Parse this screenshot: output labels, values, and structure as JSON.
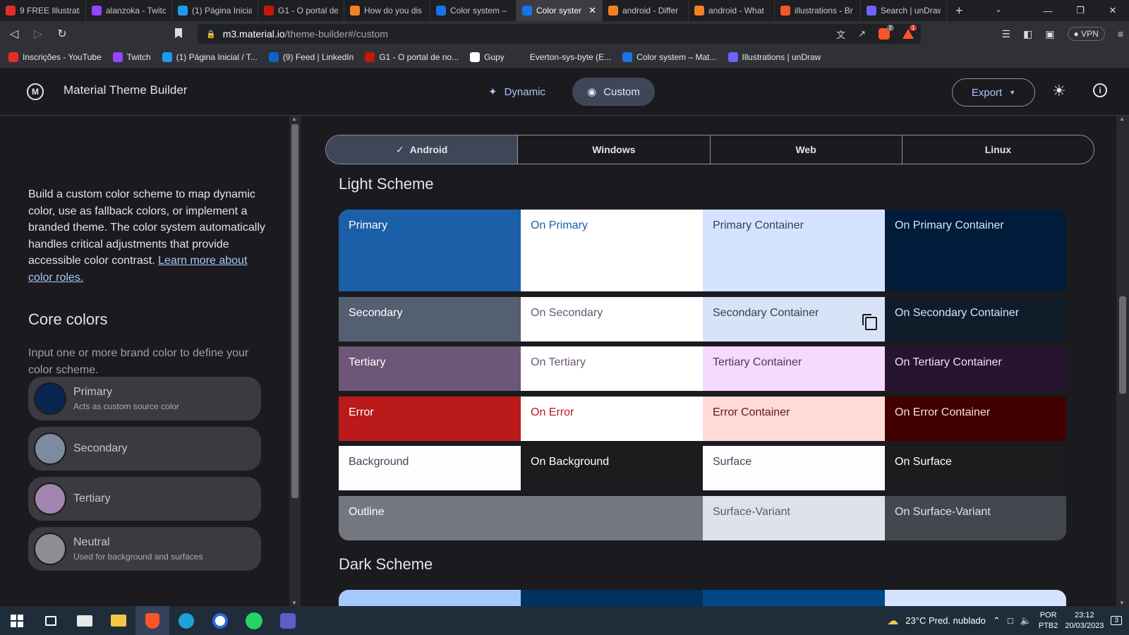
{
  "browser": {
    "tabs": [
      {
        "label": "9 FREE Illustratic",
        "fav_color": "#e52d27",
        "fav_icon": "youtube-icon"
      },
      {
        "label": "alanzoka - Twitc",
        "fav_color": "#9146ff",
        "fav_icon": "twitch-icon"
      },
      {
        "label": "(1) Página Inicia",
        "fav_color": "#1d9bf0",
        "fav_icon": "twitter-icon"
      },
      {
        "label": "G1 - O portal de",
        "fav_color": "#c4170c",
        "fav_icon": "g1-icon"
      },
      {
        "label": "How do you dis",
        "fav_color": "#f48024",
        "fav_icon": "stackoverflow-icon"
      },
      {
        "label": "Color system – ",
        "fav_color": "#1a73e8",
        "fav_icon": "material-icon"
      },
      {
        "label": "Color syster",
        "fav_color": "#1a73e8",
        "fav_icon": "material-icon",
        "active": true
      },
      {
        "label": "android - Differ",
        "fav_color": "#f48024",
        "fav_icon": "stackoverflow-icon"
      },
      {
        "label": "android - What",
        "fav_color": "#f48024",
        "fav_icon": "stackoverflow-icon"
      },
      {
        "label": "illustrations - Br",
        "fav_color": "#fb542b",
        "fav_icon": "brave-search-icon"
      },
      {
        "label": "Search | unDraw",
        "fav_color": "#6c63ff",
        "fav_icon": "undraw-icon"
      }
    ],
    "url_host": "m3.material.io",
    "url_path": "/theme-builder#/custom",
    "brave_badge": "2",
    "alert_badge": "1",
    "vpn_label": "VPN",
    "bookmarks": [
      {
        "label": "Inscrições - YouTube",
        "fav_color": "#e52d27"
      },
      {
        "label": "Twitch",
        "fav_color": "#9146ff"
      },
      {
        "label": "(1) Página Inicial / T...",
        "fav_color": "#1d9bf0"
      },
      {
        "label": "(9) Feed | LinkedIn",
        "fav_color": "#0a66c2"
      },
      {
        "label": "G1 - O portal de no...",
        "fav_color": "#c4170c"
      },
      {
        "label": "Gupy",
        "fav_color": "#ffffff"
      },
      {
        "label": "Everton-sys-byte (E...",
        "fav_color": "#333333"
      },
      {
        "label": "Color system – Mat...",
        "fav_color": "#1a73e8"
      },
      {
        "label": "Illustrations | unDraw",
        "fav_color": "#6c63ff"
      }
    ]
  },
  "header": {
    "title": "Material Theme Builder",
    "dynamic_label": "Dynamic",
    "custom_label": "Custom",
    "export_label": "Export"
  },
  "sidebar": {
    "intro": "Build a custom color scheme to map dynamic color, use as fallback colors, or implement a branded theme. The color system automatically handles critical adjustments that provide accessible color contrast.",
    "learn_more": "Learn more about color roles.",
    "core_title": "Core colors",
    "core_desc": "Input one or more brand color to define your color scheme.",
    "colors": [
      {
        "name": "Primary",
        "sub": "Acts as custom source color",
        "color": "#0a2550"
      },
      {
        "name": "Secondary",
        "sub": "",
        "color": "#7d8aa0"
      },
      {
        "name": "Tertiary",
        "sub": "",
        "color": "#a386b0"
      },
      {
        "name": "Neutral",
        "sub": "Used for background and surfaces",
        "color": "#8e8e92"
      }
    ]
  },
  "platform_tabs": [
    "Android",
    "Windows",
    "Web",
    "Linux"
  ],
  "light_title": "Light Scheme",
  "dark_title": "Dark Scheme",
  "light_scheme": [
    [
      {
        "label": "Primary",
        "bg": "#1b5fa8",
        "fg": "#ffffff"
      },
      {
        "label": "On Primary",
        "bg": "#ffffff",
        "fg": "#1b5fa8"
      },
      {
        "label": "Primary Container",
        "bg": "#d4e3ff",
        "fg": "#35425a"
      },
      {
        "label": "On Primary Container",
        "bg": "#001c3a",
        "fg": "#d4e3ff"
      }
    ],
    [
      {
        "label": "Secondary",
        "bg": "#545f71",
        "fg": "#ffffff"
      },
      {
        "label": "On Secondary",
        "bg": "#ffffff",
        "fg": "#545f71"
      },
      {
        "label": "Secondary Container",
        "bg": "#d8e3f8",
        "fg": "#354050"
      },
      {
        "label": "On Secondary Container",
        "bg": "#111c2b",
        "fg": "#d8e3f8"
      }
    ],
    [
      {
        "label": "Tertiary",
        "bg": "#6d5677",
        "fg": "#ffffff"
      },
      {
        "label": "On Tertiary",
        "bg": "#ffffff",
        "fg": "#6d5677"
      },
      {
        "label": "Tertiary Container",
        "bg": "#f6d9ff",
        "fg": "#4d3a56"
      },
      {
        "label": "On Tertiary Container",
        "bg": "#271430",
        "fg": "#f6d9ff"
      }
    ],
    [
      {
        "label": "Error",
        "bg": "#ba1a1a",
        "fg": "#ffffff"
      },
      {
        "label": "On Error",
        "bg": "#ffffff",
        "fg": "#ba1a1a"
      },
      {
        "label": "Error Container",
        "bg": "#ffdad6",
        "fg": "#5c1a15"
      },
      {
        "label": "On Error Container",
        "bg": "#410002",
        "fg": "#ffdad6"
      }
    ],
    [
      {
        "label": "Background",
        "bg": "#fdfcff",
        "fg": "#43474e"
      },
      {
        "label": "On Background",
        "bg": "#1a1c1e",
        "fg": "#ffffff"
      },
      {
        "label": "Surface",
        "bg": "#fdfcff",
        "fg": "#43474e"
      },
      {
        "label": "On Surface",
        "bg": "#1a1c1e",
        "fg": "#ffffff"
      }
    ],
    [
      {
        "label": "Outline",
        "bg": "#74777f",
        "fg": "#ffffff",
        "span": 2
      },
      {
        "label": "Surface-Variant",
        "bg": "#dfe2eb",
        "fg": "#5a5e66"
      },
      {
        "label": "On Surface-Variant",
        "bg": "#43474e",
        "fg": "#dfe2eb"
      }
    ]
  ],
  "dark_preview_colors": [
    "#a5c8ff",
    "#00315f",
    "#004787",
    "#d4e3ff"
  ],
  "taskbar": {
    "weather": "23°C  Pred. nublado",
    "lang1": "POR",
    "lang2": "PTB2",
    "time": "23:12",
    "date": "20/03/2023",
    "notif_count": "3"
  }
}
